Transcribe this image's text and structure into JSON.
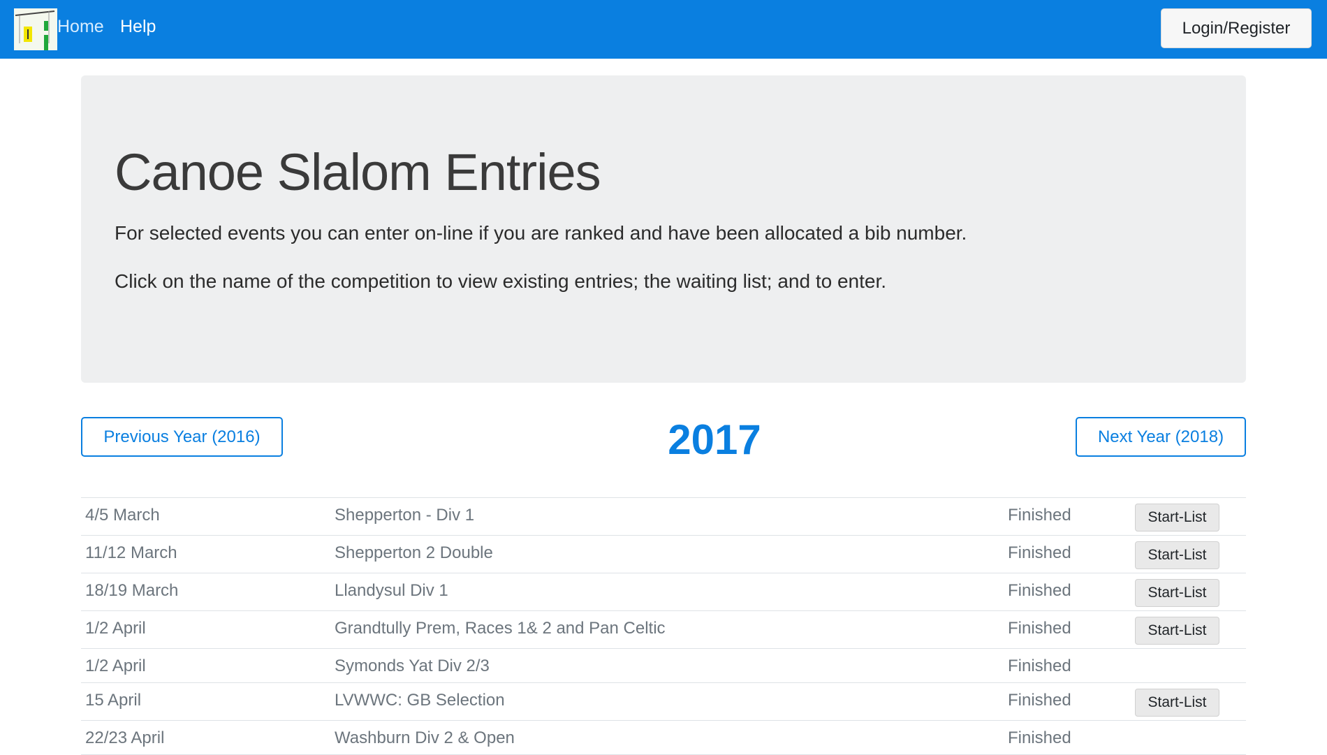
{
  "nav": {
    "home_label": "Home",
    "help_label": "Help",
    "login_label": "Login/Register",
    "brand_color": "#0a7fe0"
  },
  "jumbotron": {
    "title": "Canoe Slalom Entries",
    "text_1": "For selected events you can enter on-line if you are ranked and have been allocated a bib number.",
    "text_2": "Click on the name of the competition to view existing entries; the waiting list; and to enter."
  },
  "year_nav": {
    "prev_label": "Previous Year (2016)",
    "current_year": "2017",
    "next_label": "Next Year (2018)"
  },
  "events": [
    {
      "date": "4/5 March",
      "name": "Shepperton - Div 1",
      "status": "Finished",
      "button": "Start-List"
    },
    {
      "date": "11/12 March",
      "name": "Shepperton 2 Double",
      "status": "Finished",
      "button": "Start-List"
    },
    {
      "date": "18/19 March",
      "name": "Llandysul Div 1",
      "status": "Finished",
      "button": "Start-List"
    },
    {
      "date": "1/2 April",
      "name": "Grandtully Prem, Races 1& 2 and Pan Celtic",
      "status": "Finished",
      "button": "Start-List"
    },
    {
      "date": "1/2 April",
      "name": "Symonds Yat Div 2/3",
      "status": "Finished",
      "button": ""
    },
    {
      "date": "15 April",
      "name": "LVWWC: GB Selection",
      "status": "Finished",
      "button": "Start-List"
    },
    {
      "date": "22/23 April",
      "name": "Washburn Div 2 & Open",
      "status": "Finished",
      "button": ""
    }
  ]
}
